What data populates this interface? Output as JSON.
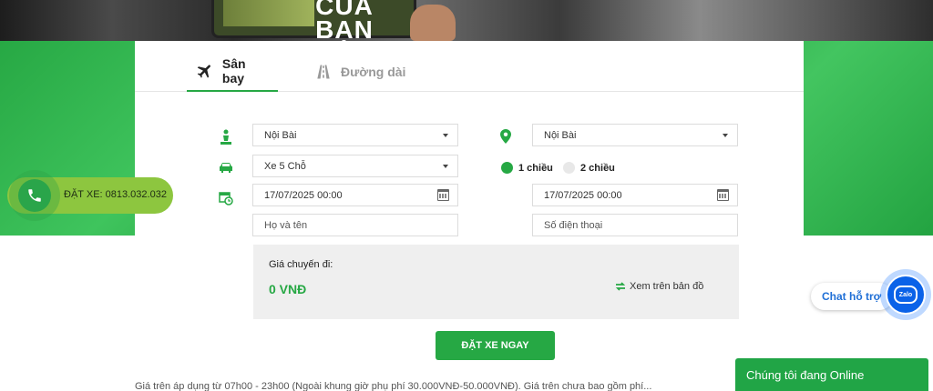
{
  "hero": {
    "headline_line1": "CỦA",
    "headline_line2": "BẠN"
  },
  "tabs": [
    {
      "label": "Sân bay",
      "icon": "airplane-icon",
      "active": true
    },
    {
      "label": "Đường dài",
      "icon": "road-icon",
      "active": false
    }
  ],
  "form": {
    "pickup": "Nội Bài",
    "dropoff": "Nội Bài",
    "vehicle": "Xe 5 Chỗ",
    "trip_type": {
      "one_way": "1 chiều",
      "round_trip": "2 chiều",
      "selected": "1 chiều"
    },
    "depart_datetime": "17/07/2025 00:00",
    "return_datetime": "17/07/2025 00:00",
    "name_placeholder": "Họ và tên",
    "phone_placeholder": "Số điện thoại"
  },
  "price": {
    "label": "Giá chuyến đi:",
    "value": "0 VNĐ",
    "map_link": "Xem trên bản đồ"
  },
  "book_button": "ĐẶT XE NGAY",
  "bottom_text": "Giá trên áp dụng từ 07h00 - 23h00 (Ngoài khung giờ phụ phí 30.000VNĐ-50.000VNĐ). Giá trên chưa bao gồm phí...",
  "call": {
    "label": "ĐẶT XE: 0813.032.032"
  },
  "chat": {
    "label": "Chat hỗ trợ",
    "zalo_label": "Zalo"
  },
  "online_bar": "Chúng tôi đang Online",
  "colors": {
    "brand_green": "#26a844",
    "call_pill": "#8dc63f",
    "zalo_blue": "#0a62e8"
  }
}
